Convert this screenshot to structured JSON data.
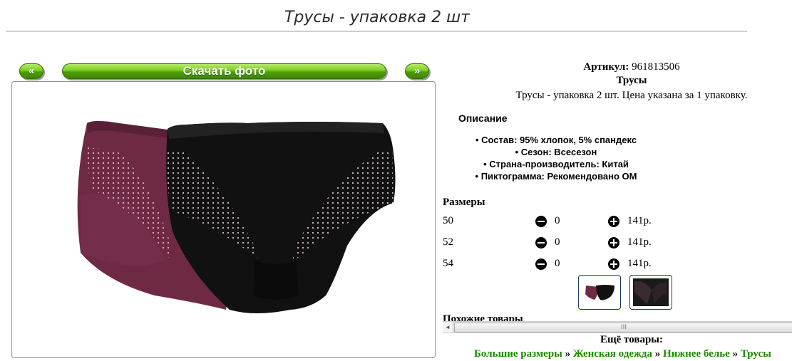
{
  "page": {
    "title": "Трусы - упаковка 2 шт"
  },
  "gallery": {
    "prev_label": "«",
    "download_label": "Скачать фото",
    "next_label": "»"
  },
  "product": {
    "article_label": "Артикул:",
    "article_value": "961813506",
    "name": "Трусы",
    "short_description": "Трусы - упаковка 2 шт. Цена указана за 1 упаковку."
  },
  "description": {
    "heading": "Описание",
    "items": [
      "Состав: 95% хлопок, 5% спандекс",
      "Сезон: Всесезон",
      "Страна-производитель: Китай",
      "Пиктограмма: Рекомендовано ОМ"
    ]
  },
  "sizes": {
    "heading": "Размеры",
    "rows": [
      {
        "size": "50",
        "qty": "0",
        "price": "141р."
      },
      {
        "size": "52",
        "qty": "0",
        "price": "141р."
      },
      {
        "size": "54",
        "qty": "0",
        "price": "141р."
      }
    ]
  },
  "similar": {
    "heading": "Похожие товары"
  },
  "scrollbar": {
    "left_arrow": "◄",
    "thumb_grip": "III"
  },
  "more": {
    "heading": "Ещё товары:",
    "crumbs": [
      "Большие размеры",
      "Женская одежда",
      "Нижнее белье",
      "Трусы"
    ],
    "separator": "»"
  },
  "colors": {
    "accent_green": "#6cc21a",
    "link_green": "#1a8a00",
    "burgundy": "#6e2a45",
    "black": "#111111"
  }
}
